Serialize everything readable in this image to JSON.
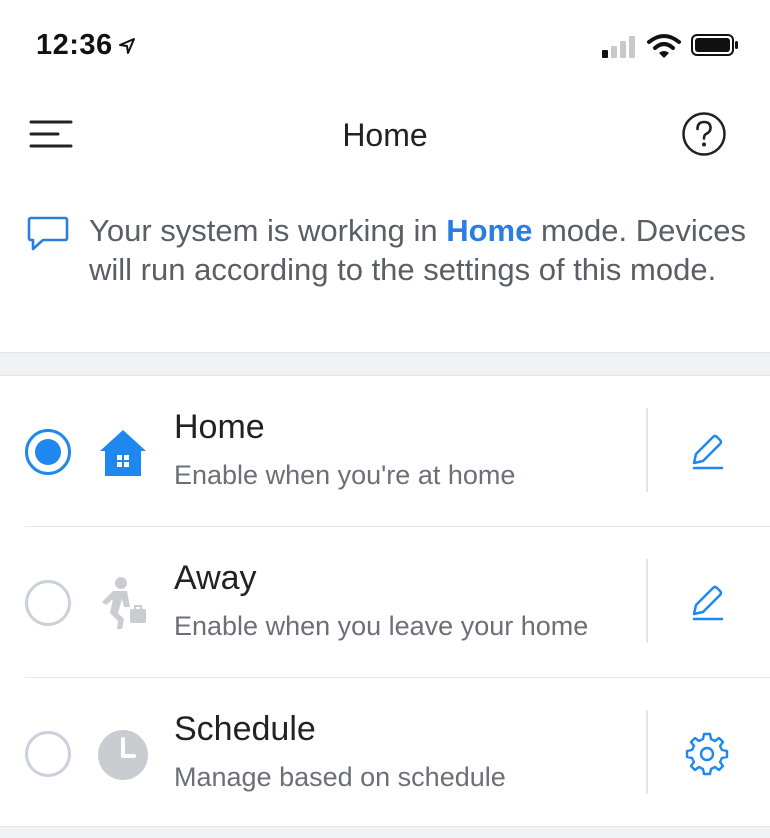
{
  "status_bar": {
    "time": "12:36",
    "location_icon": "location-arrow-icon",
    "signal_icon": "cellular-signal-icon",
    "wifi_icon": "wifi-icon",
    "battery_icon": "battery-icon"
  },
  "nav": {
    "title": "Home",
    "menu_icon": "hamburger-menu-icon",
    "help_icon": "help-circle-icon"
  },
  "info": {
    "icon": "chat-bubble-icon",
    "text_before": "Your system is working in ",
    "mode_name": "Home",
    "text_after": " mode. Devices will run according to the settings of this mode."
  },
  "modes": [
    {
      "name": "Home",
      "description": "Enable when you're at home",
      "selected": true,
      "icon": "house-icon",
      "action_icon": "edit-pencil-icon"
    },
    {
      "name": "Away",
      "description": "Enable when you leave your home",
      "selected": false,
      "icon": "walking-person-briefcase-icon",
      "action_icon": "edit-pencil-icon"
    },
    {
      "name": "Schedule",
      "description": "Manage based on schedule",
      "selected": false,
      "icon": "clock-icon",
      "action_icon": "gear-icon"
    }
  ],
  "colors": {
    "accent": "#1e88f0",
    "link": "#2a7de1",
    "inactive": "#c9d1db",
    "secondary_text": "#6b7078"
  }
}
